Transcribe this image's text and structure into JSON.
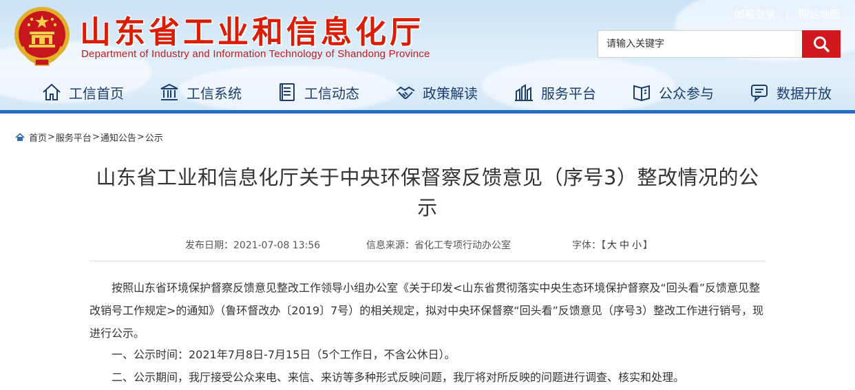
{
  "header": {
    "title": "山东省工业和信息化厅",
    "subtitle": "Department of Industry and Information Technology of Shandong Province",
    "links": {
      "mail_login": "邮箱登录",
      "separator": "|",
      "sitemap": "网站地图"
    },
    "search": {
      "placeholder": "请输入关键字",
      "value": ""
    }
  },
  "nav": {
    "items": [
      {
        "label": "工信首页",
        "icon": "home-icon"
      },
      {
        "label": "工信系统",
        "icon": "building-icon"
      },
      {
        "label": "工信动态",
        "icon": "news-icon"
      },
      {
        "label": "政策解读",
        "icon": "handshake-icon"
      },
      {
        "label": "服务平台",
        "icon": "platform-icon"
      },
      {
        "label": "公众参与",
        "icon": "book-icon"
      },
      {
        "label": "数据开放",
        "icon": "chat-icon"
      }
    ]
  },
  "breadcrumb": {
    "items": [
      "首页",
      "服务平台",
      "通知公告",
      "公示"
    ],
    "separator": ">"
  },
  "article": {
    "title": "山东省工业和信息化厅关于中央环保督察反馈意见（序号3）整改情况的公示",
    "meta": {
      "date_label": "发布日期：",
      "date": "2021-07-08 13:56",
      "source_label": "信息来源：",
      "source": "省化工专项行动办公室",
      "font_label": "字体：",
      "font_open": "【",
      "font_large": "大",
      "font_medium": "中",
      "font_small": "小",
      "font_close": "】"
    },
    "paragraphs": [
      "按照山东省环境保护督察反馈意见整改工作领导小组办公室《关于印发<山东省贯彻落实中央生态环境保护督察及“回头看”反馈意见整改销号工作规定>的通知》（鲁环督改办〔2019〕7号）的相关规定，拟对中央环保督察“回头看”反馈意见（序号3）整改工作进行销号，现进行公示。",
      "一、公示时间：2021年7月8日-7月15日（5个工作日，不含公休日）。",
      "二、公示期间，我厅接受公众来电、来信、来访等多种形式反映问题，我厅将对所反映的问题进行调查、核实和处理。"
    ]
  },
  "colors": {
    "title_red": "#d81e06",
    "search_red": "#d0191e",
    "nav_text": "#1a3d6e",
    "header_bottom_bar": "#1f6fbf"
  }
}
